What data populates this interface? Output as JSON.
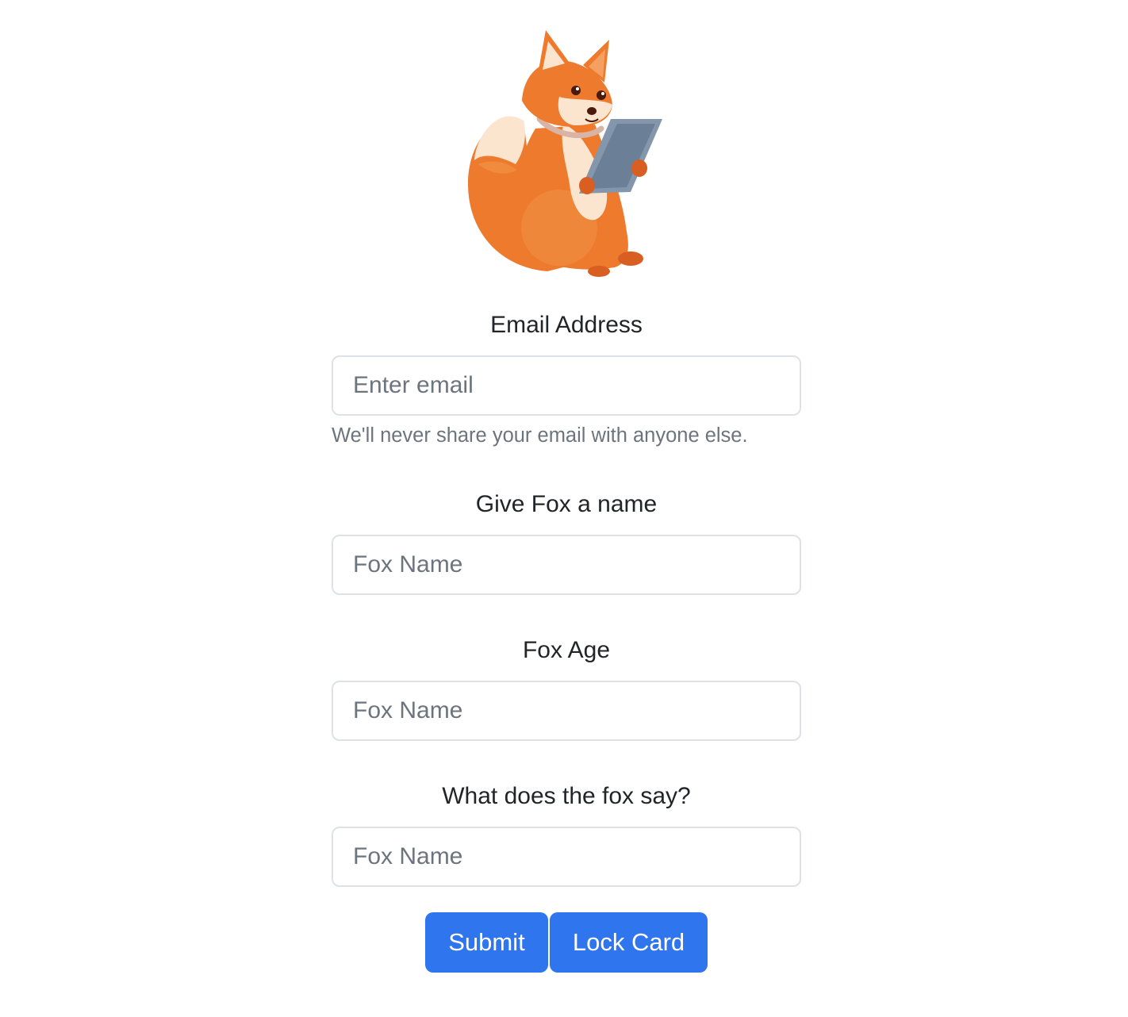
{
  "mascot": {
    "icon": "fox-with-tablet-illustration"
  },
  "form": {
    "email": {
      "label": "Email Address",
      "placeholder": "Enter email",
      "value": "",
      "help": "We'll never share your email with anyone else."
    },
    "fox_name": {
      "label": "Give Fox a name",
      "placeholder": "Fox Name",
      "value": ""
    },
    "fox_age": {
      "label": "Fox Age",
      "placeholder": "Fox Name",
      "value": ""
    },
    "fox_says": {
      "label": "What does the fox say?",
      "placeholder": "Fox Name",
      "value": ""
    },
    "submit_label": "Submit",
    "lock_label": "Lock Card"
  },
  "colors": {
    "primary": "#2f75ee",
    "input_border": "#dee2e6",
    "muted_text": "#6c757d",
    "fox_orange": "#ee7a2e"
  }
}
